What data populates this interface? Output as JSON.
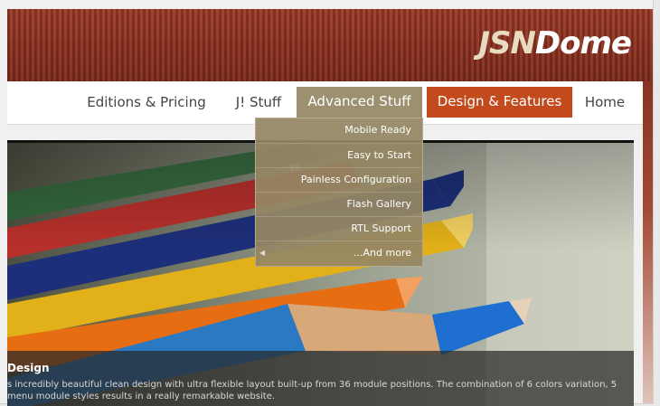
{
  "logo": {
    "prefix": "JSN",
    "suffix": "Dome"
  },
  "nav": {
    "items": [
      {
        "label": "Editions & Pricing"
      },
      {
        "label": "J! Stuff"
      },
      {
        "label": "Advanced Stuff"
      },
      {
        "label": "Design & Features"
      },
      {
        "label": "Home"
      }
    ]
  },
  "dropdown": {
    "items": [
      {
        "label": "Mobile Ready"
      },
      {
        "label": "Easy to Start"
      },
      {
        "label": "Painless Configuration"
      },
      {
        "label": "Flash Gallery"
      },
      {
        "label": "RTL Support"
      },
      {
        "label": "...And more"
      }
    ]
  },
  "slide": {
    "title": "Design",
    "text": "s incredibly beautiful clean design with ultra flexible layout built-up from 36 module positions. The combination of 6 colors variation, 5 menu module styles results in a really remarkable website."
  },
  "colors": {
    "header_red": "#8f3422",
    "active_tan": "#9c9070",
    "highlight_orange": "#c24a1c"
  }
}
